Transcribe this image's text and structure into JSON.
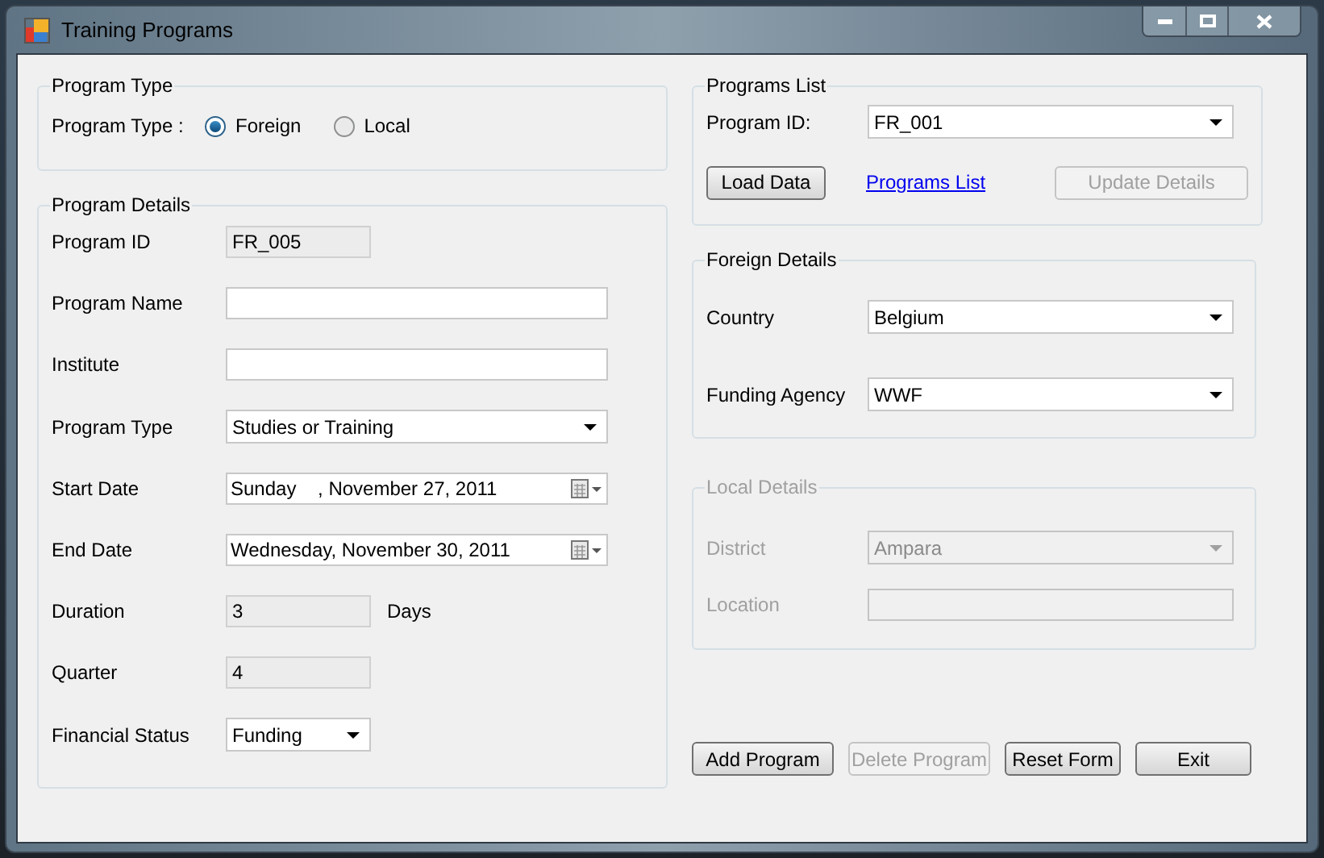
{
  "window": {
    "title": "Training Programs"
  },
  "program_type": {
    "title": "Program Type",
    "label": "Program Type :",
    "options": [
      {
        "label": "Foreign",
        "selected": true
      },
      {
        "label": "Local",
        "selected": false
      }
    ]
  },
  "program_details": {
    "title": "Program Details",
    "fields": [
      {
        "kind": "text",
        "label": "Program ID",
        "value": "FR_005",
        "readonly": true
      },
      {
        "kind": "text",
        "label": "Program Name",
        "readonly": false
      },
      {
        "kind": "text",
        "label": "Institute",
        "readonly": false
      },
      {
        "kind": "combo",
        "label": "Program Type",
        "value": "Studies or Training",
        "readonly": false
      },
      {
        "kind": "date",
        "label": "Start Date",
        "value": "Sunday    , November 27, 2011",
        "readonly": false
      },
      {
        "kind": "date",
        "label": "End Date",
        "value": "Wednesday, November 30, 2011",
        "readonly": false
      },
      {
        "kind": "text",
        "label": "Duration",
        "value": "3",
        "suffix": "Days",
        "readonly": true
      },
      {
        "kind": "text",
        "label": "Quarter",
        "value": "4",
        "readonly": true
      },
      {
        "kind": "combo",
        "label": "Financial Status",
        "value": "Funding",
        "readonly": false,
        "short": true
      }
    ]
  },
  "programs_list": {
    "title": "Programs List",
    "label": "Program ID:",
    "value": "FR_001",
    "load_button": {
      "label": "Load Data",
      "disabled": false
    },
    "link": "Programs List",
    "update_button": {
      "label": "Update Details",
      "disabled": true
    }
  },
  "foreign_details": {
    "title": "Foreign Details",
    "disabled": false,
    "fields": [
      {
        "kind": "combo",
        "label": "Country",
        "value": "Belgium"
      },
      {
        "kind": "combo",
        "label": "Funding Agency",
        "value": "WWF"
      }
    ]
  },
  "local_details": {
    "title": "Local Details",
    "disabled": true,
    "fields": [
      {
        "kind": "combo",
        "label": "District",
        "value": "Ampara"
      },
      {
        "kind": "text",
        "label": "Location"
      }
    ]
  },
  "buttons": [
    {
      "label": "Add Program",
      "disabled": false
    },
    {
      "label": "Delete Program",
      "disabled": true
    },
    {
      "label": "Reset Form",
      "disabled": false
    },
    {
      "label": "Exit",
      "disabled": false
    }
  ]
}
